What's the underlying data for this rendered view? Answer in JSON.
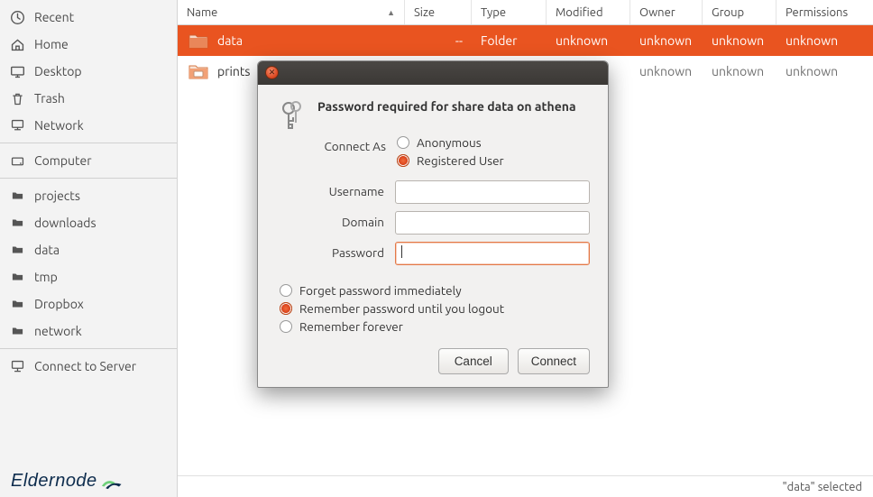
{
  "sidebar": {
    "places": [
      {
        "label": "Recent",
        "icon": "clock-icon"
      },
      {
        "label": "Home",
        "icon": "home-icon"
      },
      {
        "label": "Desktop",
        "icon": "desktop-icon"
      },
      {
        "label": "Trash",
        "icon": "trash-icon"
      },
      {
        "label": "Network",
        "icon": "network-icon"
      }
    ],
    "devices": [
      {
        "label": "Computer",
        "icon": "drive-icon"
      }
    ],
    "bookmarks": [
      {
        "label": "projects",
        "icon": "folder-icon"
      },
      {
        "label": "downloads",
        "icon": "folder-icon"
      },
      {
        "label": "data",
        "icon": "folder-icon"
      },
      {
        "label": "tmp",
        "icon": "folder-icon"
      },
      {
        "label": "Dropbox",
        "icon": "folder-icon"
      },
      {
        "label": "network",
        "icon": "folder-icon"
      }
    ],
    "network": [
      {
        "label": "Connect to Server",
        "icon": "connect-server-icon"
      }
    ]
  },
  "columns": {
    "name": "Name",
    "size": "Size",
    "type": "Type",
    "modified": "Modified",
    "owner": "Owner",
    "group": "Group",
    "permissions": "Permissions"
  },
  "rows": [
    {
      "name": "data",
      "size": "--",
      "type": "Folder",
      "modified": "unknown",
      "owner": "unknown",
      "group": "unknown",
      "permissions": "unknown",
      "selected": true
    },
    {
      "name": "prints",
      "size": "",
      "type": "",
      "modified": "",
      "owner": "unknown",
      "group": "unknown",
      "permissions": "unknown",
      "selected": false
    }
  ],
  "status": "\"data\" selected",
  "logo": "Eldernode",
  "dialog": {
    "heading": "Password required for share data on athena",
    "connect_as_label": "Connect As",
    "anonymous": "Anonymous",
    "registered": "Registered User",
    "username_label": "Username",
    "domain_label": "Domain",
    "password_label": "Password",
    "username_value": "",
    "domain_value": "",
    "password_value": "",
    "forget": "Forget password immediately",
    "remember_logout": "Remember password until you logout",
    "remember_forever": "Remember forever",
    "cancel": "Cancel",
    "connect": "Connect"
  }
}
